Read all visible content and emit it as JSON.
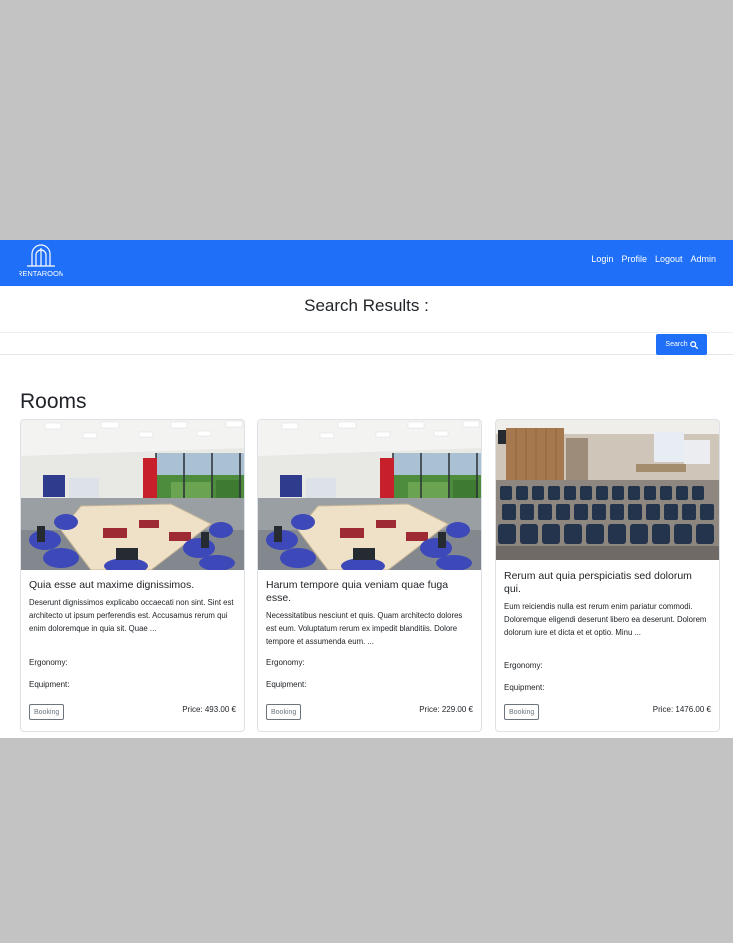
{
  "navbar": {
    "brand": "RENTAROOM",
    "links": [
      "Login",
      "Profile",
      "Logout",
      "Admin"
    ]
  },
  "search": {
    "title": "Search Results :",
    "button_label": "Search"
  },
  "rooms": {
    "heading": "Rooms",
    "cards": [
      {
        "title": "Quia esse aut maxime dignissimos.",
        "description": "Deserunt dignissimos explicabo occaecati non sint. Sint est architecto ut ipsum perferendis est. Accusamus rerum qui enim doloremque in quia sit. Quae ...",
        "ergonomy_label": "Ergonomy:",
        "equipment_label": "Equipment:",
        "booking_label": "Booking",
        "price": "Price: 493.00 €",
        "image": "meeting-room-photo"
      },
      {
        "title": "Harum tempore quia veniam quae fuga esse.",
        "description": "Necessitatibus nesciunt et quis. Quam architecto dolores est eum. Voluptatum rerum ex impedit blanditiis. Dolore tempore et assumenda eum. ...",
        "ergonomy_label": "Ergonomy:",
        "equipment_label": "Equipment:",
        "booking_label": "Booking",
        "price": "Price: 229.00 €",
        "image": "meeting-room-photo"
      },
      {
        "title": "Rerum aut quia perspiciatis sed dolorum qui.",
        "description": "Eum reiciendis nulla est rerum enim pariatur commodi. Doloremque eligendi deserunt libero ea deserunt. Dolorem dolorum iure et dicta et et optio. Minu ...",
        "ergonomy_label": "Ergonomy:",
        "equipment_label": "Equipment:",
        "booking_label": "Booking",
        "price": "Price: 1476.00 €",
        "image": "auditorium-photo"
      }
    ]
  },
  "colors": {
    "primary": "#1f6ff9",
    "backdrop": "#c3c3c3"
  }
}
